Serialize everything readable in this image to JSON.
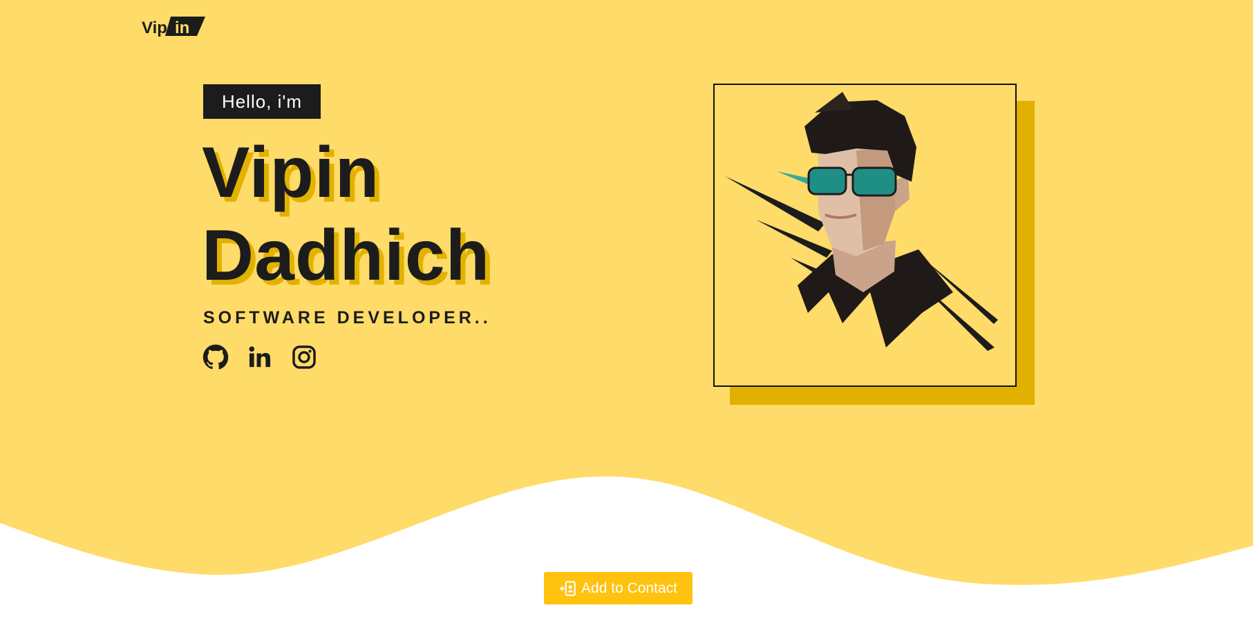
{
  "brand": {
    "logo_text_left": "Vip",
    "logo_text_right": "in"
  },
  "hero": {
    "greeting": "Hello, i'm",
    "first_name": "Vipin",
    "last_name": "Dadhich",
    "role": "SOFTWARE DEVELOPER.."
  },
  "social": [
    {
      "icon": "github-icon"
    },
    {
      "icon": "linkedin-icon"
    },
    {
      "icon": "instagram-icon"
    }
  ],
  "cta": {
    "label": "Add to Contact",
    "icon": "add-contact-icon"
  },
  "colors": {
    "hero_background": "#ffdb69",
    "accent_shadow": "#e2b200",
    "button": "#ffc20e",
    "text_dark": "#1c1c1c"
  }
}
